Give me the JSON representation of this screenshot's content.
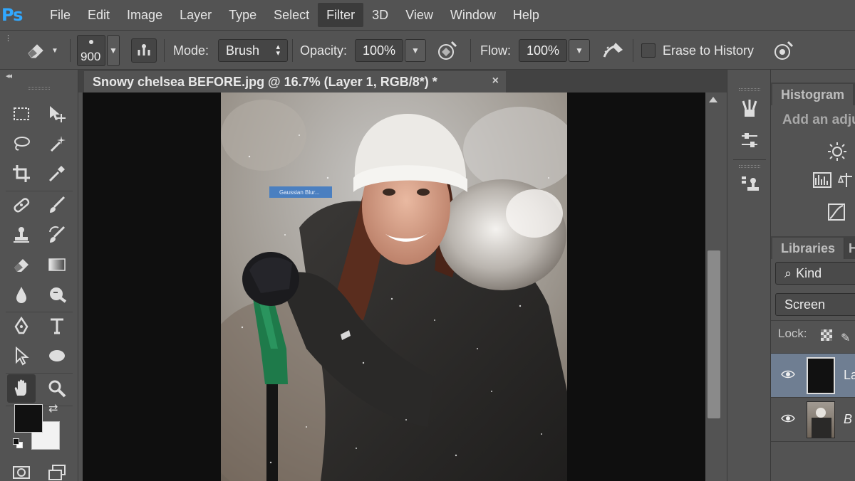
{
  "app": {
    "logo": "Ps",
    "menu": [
      "File",
      "Edit",
      "Image",
      "Layer",
      "Type",
      "Select",
      "Filter",
      "3D",
      "View",
      "Window",
      "Help"
    ],
    "active_menu": "Filter"
  },
  "options_bar": {
    "brush_size": "900",
    "mode_label": "Mode:",
    "mode_value": "Brush",
    "opacity_label": "Opacity:",
    "opacity_value": "100%",
    "flow_label": "Flow:",
    "flow_value": "100%",
    "erase_to_history_label": "Erase to History",
    "erase_to_history_checked": false
  },
  "document": {
    "tab_title": "Snowy chelsea BEFORE.jpg @ 16.7% (Layer 1, RGB/8*) *",
    "close_glyph": "×",
    "overlay_label": "Gaussian Blur..."
  },
  "panels": {
    "histogram_tab": "Histogram",
    "adjustments_hint": "Add an adju",
    "libraries_tab": "Libraries",
    "libraries_tab2": "H",
    "filter_kind": "Kind",
    "blend_mode": "Screen",
    "lock_label": "Lock:",
    "layers": [
      {
        "name": "La",
        "visible": true,
        "selected": true
      },
      {
        "name": "B",
        "visible": true,
        "selected": false
      }
    ]
  },
  "colors": {
    "foreground": "#111111",
    "background": "#f2f2f2",
    "accent_blue": "#31a8ff"
  }
}
